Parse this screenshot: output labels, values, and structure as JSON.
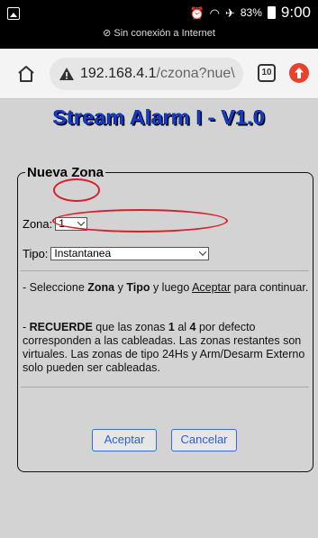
{
  "status_bar": {
    "battery": "83%",
    "time": "9:00",
    "network_message": "Sin conexión a Internet"
  },
  "browser": {
    "url_host": "192.168.4.1",
    "url_path": "/czona?nue\\",
    "tab_count": "10"
  },
  "page": {
    "title": "Stream Alarm I - V1.0",
    "form": {
      "legend": "Nueva Zona",
      "zona_label": "Zona:",
      "zona_value": "1",
      "tipo_label": "Tipo:",
      "tipo_value": "Instantanea",
      "instructions": {
        "prefix": "- Seleccione ",
        "zona": "Zona",
        "y1": " y ",
        "tipo": "Tipo",
        "middle": " y luego ",
        "aceptar": "Aceptar",
        "suffix": " para continuar."
      },
      "reminder": {
        "prefix": "- ",
        "recuerde": "RECUERDE",
        "text1": " que las zonas ",
        "n1": "1",
        "al": " al ",
        "n4": "4",
        "text2": " por defecto corresponden a las cableadas. Las zonas restantes son virtuales. Las zonas de tipo 24Hs y Arm/Desarm Externo solo pueden ser cableadas."
      },
      "accept_label": "Aceptar",
      "cancel_label": "Cancelar"
    }
  },
  "annotations": {
    "ring_color": "#d8202a"
  }
}
